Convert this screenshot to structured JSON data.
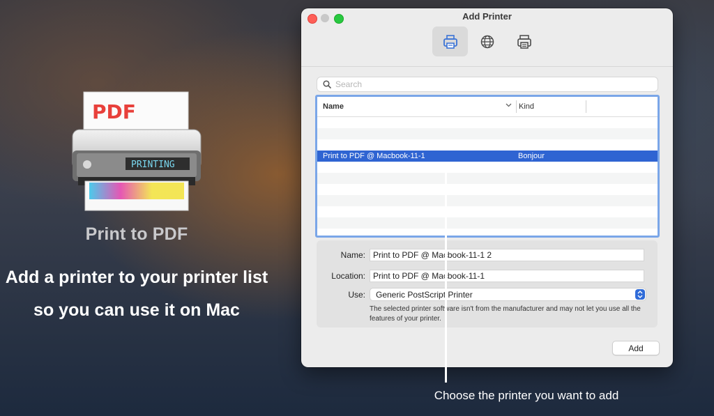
{
  "promo": {
    "icon_name": "pdf-printer-app-icon",
    "icon_pdf_text": "PDF",
    "icon_screen_text": "PRINTING",
    "app_name": "Print to PDF",
    "headline_line1": "Add a printer to your printer list",
    "headline_line2": "so you can use it on Mac"
  },
  "window": {
    "title": "Add Printer",
    "toolbar": [
      {
        "icon": "default-printer-icon",
        "active": true
      },
      {
        "icon": "ip-globe-icon",
        "active": false
      },
      {
        "icon": "windows-printer-icon",
        "active": false
      }
    ],
    "search": {
      "placeholder": "Search",
      "value": ""
    },
    "table": {
      "columns": {
        "name": "Name",
        "kind": "Kind"
      },
      "rows": [
        {
          "name": "",
          "kind": ""
        },
        {
          "name": "",
          "kind": ""
        },
        {
          "name": "",
          "kind": ""
        },
        {
          "name": "Print to PDF @ Macbook-11-1",
          "kind": "Bonjour",
          "selected": true
        },
        {
          "name": "",
          "kind": ""
        },
        {
          "name": "",
          "kind": ""
        },
        {
          "name": "",
          "kind": ""
        },
        {
          "name": "",
          "kind": ""
        },
        {
          "name": "",
          "kind": ""
        },
        {
          "name": "",
          "kind": ""
        }
      ]
    },
    "details": {
      "name_label": "Name:",
      "name_value": "Print to PDF @ Macbook-11-1 2",
      "location_label": "Location:",
      "location_value": "Print to PDF @ Macbook-11-1",
      "use_label": "Use:",
      "use_value": "Generic PostScript Printer",
      "note": "The selected printer software isn't from the manufacturer and may not let you use all the features of your printer."
    },
    "add_button": "Add"
  },
  "caption": "Choose the printer you want to add",
  "colors": {
    "selection": "#2f64d2",
    "focus_ring": "#7aa6e8",
    "close": "#fe5f57",
    "maximize": "#28c840"
  }
}
